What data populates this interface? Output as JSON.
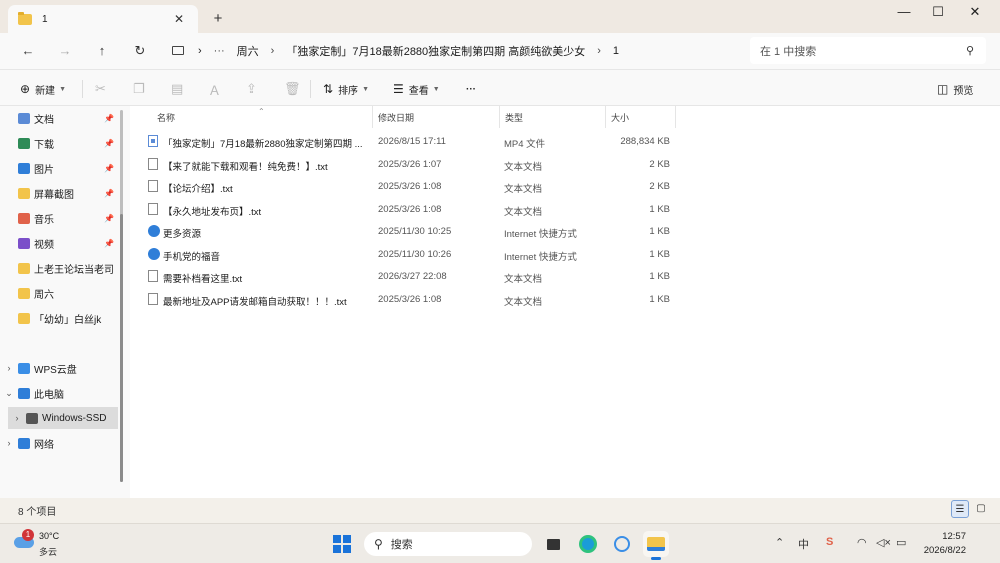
{
  "window": {
    "tab_title": "1",
    "new_tab": "+",
    "controls": {
      "minimize": "—",
      "maximize": "☐",
      "close": "✕"
    }
  },
  "address": {
    "more": "···",
    "crumbs": [
      "周六",
      "「独家定制」7月18最新2880独家定制第四期 高颜纯欲美少女",
      "1"
    ],
    "search_placeholder": "在 1 中搜索"
  },
  "toolbar": {
    "new_label": "新建",
    "sort_label": "排序",
    "view_label": "查看",
    "more_label": "···",
    "preview_label": "预览"
  },
  "nav": {
    "items": [
      {
        "label": "文档",
        "color": "#5b8bd6",
        "pinned": true
      },
      {
        "label": "下载",
        "color": "#2e8b57",
        "pinned": true
      },
      {
        "label": "图片",
        "color": "#2f7ed8",
        "pinned": true
      },
      {
        "label": "屏幕截图",
        "color": "#f2c44b",
        "pinned": true
      },
      {
        "label": "音乐",
        "color": "#e0624a",
        "pinned": true
      },
      {
        "label": "视频",
        "color": "#7b4fc9",
        "pinned": true
      },
      {
        "label": "上老王论坛当老司",
        "color": "#f2c44b",
        "pinned": false
      },
      {
        "label": "周六",
        "color": "#f2c44b",
        "pinned": false
      },
      {
        "label": "「幼幼」白丝jk",
        "color": "#f2c44b",
        "pinned": false
      }
    ],
    "tree": [
      {
        "label": "WPS云盘",
        "expander": "›",
        "color": "#3a8ee6"
      },
      {
        "label": "此电脑",
        "expander": "⌄",
        "color": "#2f7ed8"
      },
      {
        "label": "Windows-SSD",
        "expander": "›",
        "color": "#555555"
      },
      {
        "label": "网络",
        "expander": "›",
        "color": "#2f7ed8"
      }
    ]
  },
  "columns": {
    "name": "名称",
    "date": "修改日期",
    "type": "类型",
    "size": "大小"
  },
  "files": [
    {
      "name": "「独家定制」7月18最新2880独家定制第四期 高颜纯欲美少女.mp4",
      "display_name": "「独家定制」7月18最新2880独家定制第四期 ...",
      "date": "2026/8/15 17:11",
      "type": "MP4 文件",
      "size": "288,834 KB",
      "icon": "mp4"
    },
    {
      "name": "【来了就能下载和观看！纯免费！】.txt",
      "display_name": "【来了就能下载和观看！纯免费！】.txt",
      "date": "2025/3/26 1:07",
      "type": "文本文档",
      "size": "2 KB",
      "icon": "txt"
    },
    {
      "name": "【论坛介绍】.txt",
      "display_name": "【论坛介绍】.txt",
      "date": "2025/3/26 1:08",
      "type": "文本文档",
      "size": "2 KB",
      "icon": "txt"
    },
    {
      "name": "【永久地址发布页】.txt",
      "display_name": "【永久地址发布页】.txt",
      "date": "2025/3/26 1:08",
      "type": "文本文档",
      "size": "1 KB",
      "icon": "txt"
    },
    {
      "name": "更多资源",
      "display_name": "更多资源",
      "date": "2025/11/30 10:25",
      "type": "Internet 快捷方式",
      "size": "1 KB",
      "icon": "web"
    },
    {
      "name": "手机党的福音",
      "display_name": "手机党的福音",
      "date": "2025/11/30 10:26",
      "type": "Internet 快捷方式",
      "size": "1 KB",
      "icon": "web"
    },
    {
      "name": "需要补档看这里.txt",
      "display_name": "需要补档看这里.txt",
      "date": "2026/3/27 22:08",
      "type": "文本文档",
      "size": "1 KB",
      "icon": "txt"
    },
    {
      "name": "最新地址及APP请发邮箱自动获取！！！.txt",
      "display_name": "最新地址及APP请发邮箱自动获取！！！.txt",
      "date": "2025/3/26 1:08",
      "type": "文本文档",
      "size": "1 KB",
      "icon": "txt"
    }
  ],
  "status": {
    "item_count": "8 个项目"
  },
  "taskbar": {
    "weather_badge": "1",
    "temperature": "30°C",
    "condition": "多云",
    "search_label": "搜索",
    "ime": "中",
    "time": "12:57",
    "date": "2026/8/22"
  },
  "colors": {
    "accent": "#1a73d9",
    "folder": "#f2c44b",
    "selection": "#dcdcdc"
  }
}
